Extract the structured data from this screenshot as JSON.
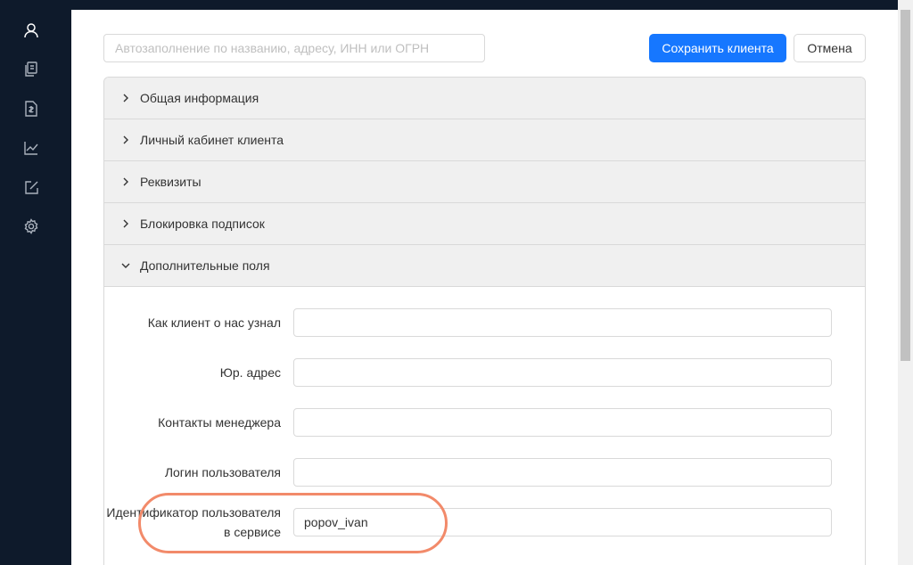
{
  "sidebar": {
    "items": [
      {
        "icon": "user-icon"
      },
      {
        "icon": "documents-icon"
      },
      {
        "icon": "invoice-icon"
      },
      {
        "icon": "chart-icon"
      },
      {
        "icon": "edit-icon"
      },
      {
        "icon": "gear-icon"
      }
    ]
  },
  "toolbar": {
    "autofill_placeholder": "Автозаполнение по названию, адресу, ИНН или ОГРН",
    "save_label": "Сохранить клиента",
    "cancel_label": "Отмена"
  },
  "panels": [
    {
      "label": "Общая информация",
      "expanded": false
    },
    {
      "label": "Личный кабинет клиента",
      "expanded": false
    },
    {
      "label": "Реквизиты",
      "expanded": false
    },
    {
      "label": "Блокировка подписок",
      "expanded": false
    },
    {
      "label": "Дополнительные поля",
      "expanded": true
    }
  ],
  "extra_fields": [
    {
      "label": "Как клиент о нас узнал",
      "value": ""
    },
    {
      "label": "Юр. адрес",
      "value": ""
    },
    {
      "label": "Контакты менеджера",
      "value": ""
    },
    {
      "label": "Логин пользователя",
      "value": ""
    },
    {
      "label": "Идентификатор пользователя в сервисе",
      "value": "popov_ivan"
    }
  ],
  "colors": {
    "sidebar_bg": "#0e1a2b",
    "primary": "#1677ff",
    "highlight": "#f28a6a"
  }
}
